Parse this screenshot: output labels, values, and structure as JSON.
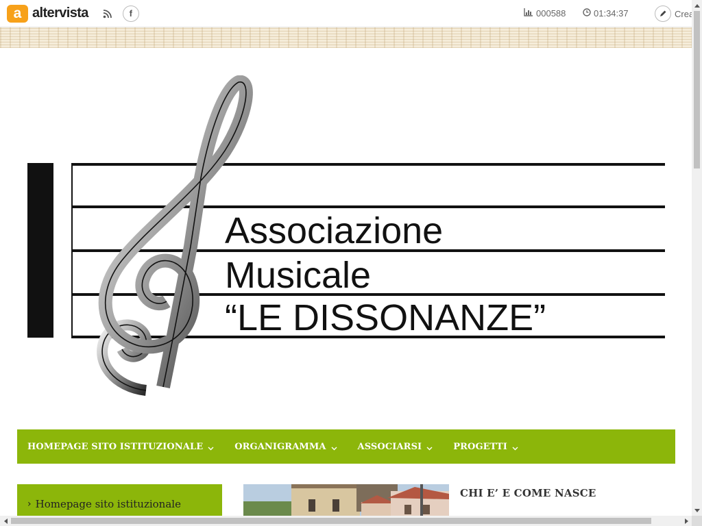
{
  "topbar": {
    "brand_letter": "a",
    "brand_name": "altervista",
    "facebook_glyph": "f",
    "visits": "000588",
    "time": "01:34:37",
    "create_label": "Crea"
  },
  "header": {
    "logo_line1": "Associazione",
    "logo_line2": "Musicale",
    "logo_line3": "“LE DISSONANZE”"
  },
  "nav": {
    "items": [
      {
        "label": "HOMEPAGE SITO ISTITUZIONALE"
      },
      {
        "label": "ORGANIGRAMMA"
      },
      {
        "label": "ASSOCIARSI"
      },
      {
        "label": "PROGETTI"
      }
    ]
  },
  "sidebar": {
    "items": [
      {
        "label": "Homepage sito istituzionale"
      }
    ]
  },
  "post": {
    "title": "CHI E’ E COME NASCE"
  },
  "colors": {
    "accent": "#8cb60a",
    "brand_orange": "#f7a11a"
  },
  "icons": [
    "rss-icon",
    "facebook-icon",
    "bar-chart-icon",
    "clock-icon",
    "pencil-icon",
    "chevron-down-icon",
    "chevron-right-icon",
    "treble-clef"
  ]
}
